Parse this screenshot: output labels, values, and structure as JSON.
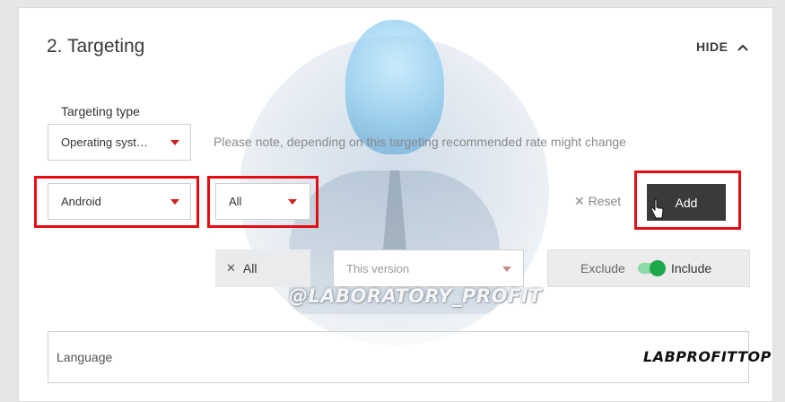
{
  "header": {
    "title": "2. Targeting",
    "hide_label": "HIDE"
  },
  "targeting_type": {
    "label": "Targeting type",
    "selected": "Operating syst…"
  },
  "note": "Please note, depending on this targeting recommended rate might change",
  "os_select": {
    "selected": "Android"
  },
  "version_filter": {
    "selected": "All"
  },
  "actions": {
    "reset_label": "Reset",
    "add_label": "Add"
  },
  "chip": {
    "label": "All"
  },
  "version_select": {
    "placeholder": "This version"
  },
  "include_toggle": {
    "exclude_label": "Exclude",
    "include_label": "Include",
    "state": "include"
  },
  "language": {
    "label": "Language"
  },
  "overlay": {
    "watermark_text": "@LABORATORY_PROFIT",
    "logo_text": "LABPROFITTOP"
  },
  "colors": {
    "highlight": "#e30d13",
    "caret": "#d21f1f",
    "toggle_on": "#1ca84a",
    "add_button": "#3a3a3a"
  },
  "icons": [
    "chevron-up-icon",
    "dropdown-caret-icon",
    "close-icon",
    "hand-cursor-icon"
  ]
}
